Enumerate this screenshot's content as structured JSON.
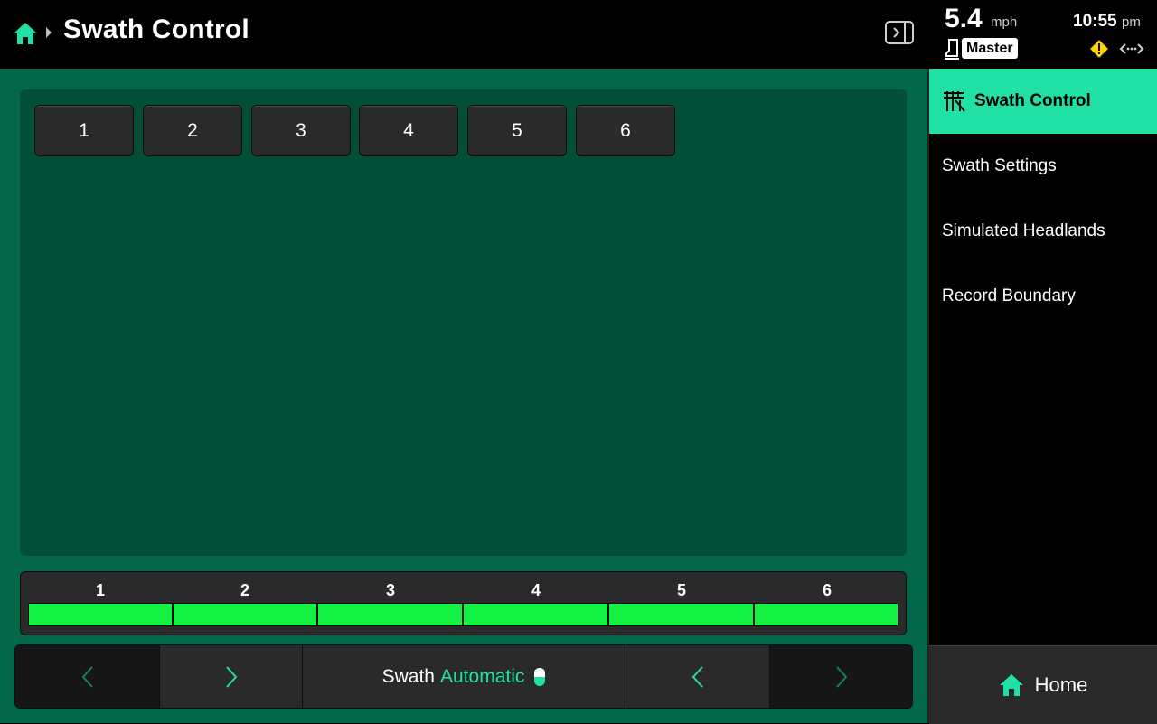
{
  "header": {
    "title": "Swath Control",
    "icons": {
      "home": "home-icon",
      "breadcrumb": "chevron-right-icon",
      "panel_toggle": "panel-toggle-icon"
    }
  },
  "status": {
    "speed": "5.4",
    "speed_unit": "mph",
    "time": "10:55",
    "ampm": "pm",
    "master_label": "Master",
    "icons": {
      "master": "master-switch-icon",
      "warning": "warning-icon",
      "connection": "connection-icon"
    }
  },
  "sections": {
    "buttons": [
      "1",
      "2",
      "3",
      "4",
      "5",
      "6"
    ],
    "bar_labels": [
      "1",
      "2",
      "3",
      "4",
      "5",
      "6"
    ],
    "bar_color": "#14f244"
  },
  "controls": {
    "swath_label": "Swath",
    "swath_mode": "Automatic",
    "icons": {
      "left1": "chevron-left-icon",
      "right1": "chevron-right-icon",
      "left2": "chevron-left-icon",
      "right2": "chevron-right-icon",
      "toggle": "toggle-icon"
    }
  },
  "sidebar": {
    "items": [
      {
        "label": "Swath Control",
        "active": true
      },
      {
        "label": "Swath Settings",
        "active": false
      },
      {
        "label": "Simulated Headlands",
        "active": false
      },
      {
        "label": "Record Boundary",
        "active": false
      }
    ],
    "home_label": "Home"
  },
  "colors": {
    "accent": "#21e0a5",
    "main_bg": "#03674a",
    "panel_bg": "#024e36",
    "warning": "#ffd400"
  }
}
